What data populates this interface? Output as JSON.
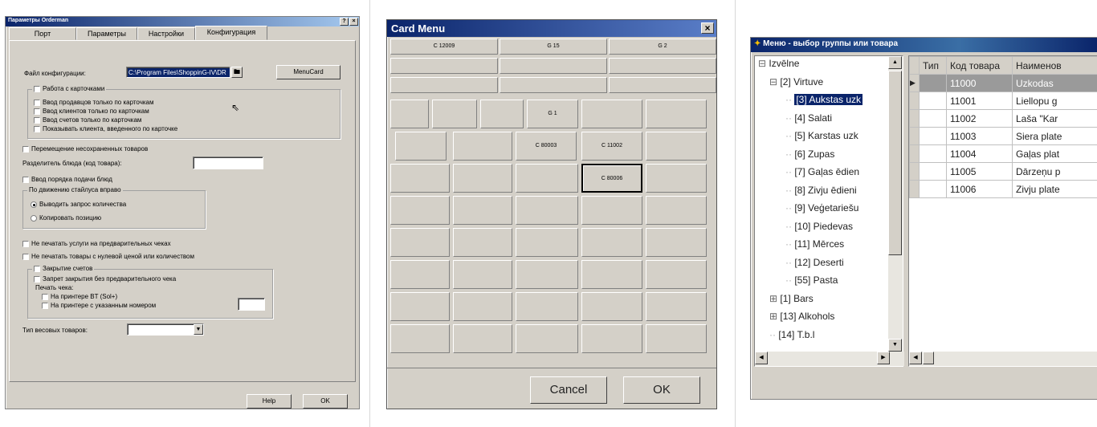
{
  "orderman": {
    "title": "Параметры Orderman",
    "help_glyph": "?",
    "close_glyph": "×",
    "tabs": [
      "Порт",
      "Параметры",
      "Настройки",
      "Конфигурация"
    ],
    "config_file_label": "Файл конфигурации:",
    "config_file_value": "C:\\Program Files\\ShoppinG-IV\\DR",
    "menucard_button": "MenuCard",
    "cards_group_title": "Работа с карточками",
    "cards_items": [
      "Ввод продавцов только по карточкам",
      "Ввод клиентов только по карточкам",
      "Ввод счетов только по карточкам",
      "Показывать клиента, введенного по карточке"
    ],
    "move_unsaved": "Перемещение несохраненных товаров",
    "dish_separator_label": "Разделитель блюда (код товара):",
    "dish_order_input": "Ввод порядка подачи блюд",
    "stylus_group_title": "По движению стайлуса вправо",
    "stylus_options": [
      "Выводить запрос количества",
      "Копировать позицию"
    ],
    "no_print_services": "Не печатать услуги на предварительных чеках",
    "no_print_zero": "Не печатать товары с нулевой ценой или количеством",
    "close_group_title": "Закрытие счетов",
    "forbid_close": "Запрет закрытия без предварительного чека",
    "print_receipt_label": "Печать чека:",
    "printer_bt": "На принтере BT (Sol+)",
    "printer_number": "На принтере с указанным номером",
    "weight_type_label": "Тип весовых товаров:",
    "help_button": "Help",
    "ok_button": "OK"
  },
  "cardmenu": {
    "title": "Card Menu",
    "close_glyph": "×",
    "top_row": [
      "C 12009",
      "G 15",
      "G 2"
    ],
    "g1": "G 1",
    "c80003": "C 80003",
    "c11002": "C 11002",
    "c80006": "C 80006",
    "cancel_button": "Cancel",
    "ok_button": "OK"
  },
  "menu": {
    "title": "Меню - выбор группы или товара",
    "tree": [
      {
        "label": "Izvēlne",
        "prefix": "⊟"
      },
      {
        "label": "[2] Virtuve",
        "prefix": "⊟"
      },
      {
        "label": "[3] Aukstas uzk",
        "prefix": ""
      },
      {
        "label": "[4] Salati",
        "prefix": ""
      },
      {
        "label": "[5] Karstas uzk",
        "prefix": ""
      },
      {
        "label": "[6] Zupas",
        "prefix": ""
      },
      {
        "label": "[7] Gaļas ēdien",
        "prefix": ""
      },
      {
        "label": "[8] Zivju ēdieni",
        "prefix": ""
      },
      {
        "label": "[9] Veģetariešu",
        "prefix": ""
      },
      {
        "label": "[10] Piedevas",
        "prefix": ""
      },
      {
        "label": "[11] Mērces",
        "prefix": ""
      },
      {
        "label": "[12] Deserti",
        "prefix": ""
      },
      {
        "label": "[55] Pasta",
        "prefix": ""
      },
      {
        "label": "[1] Bars",
        "prefix": "⊞"
      },
      {
        "label": "[13] Alkohols",
        "prefix": "⊞"
      },
      {
        "label": "[14] T.b.l",
        "prefix": ""
      }
    ],
    "columns": [
      "Тип",
      "Код товара",
      "Наименов"
    ],
    "rows": [
      {
        "code": "11000",
        "name": "Uzkodas"
      },
      {
        "code": "11001",
        "name": "Liellopu g"
      },
      {
        "code": "11002",
        "name": "Laša \"Kar"
      },
      {
        "code": "11003",
        "name": "Siera plate"
      },
      {
        "code": "11004",
        "name": "Gaļas plat"
      },
      {
        "code": "11005",
        "name": "Dārzeņu p"
      },
      {
        "code": "11006",
        "name": "Zivju plate"
      }
    ]
  }
}
